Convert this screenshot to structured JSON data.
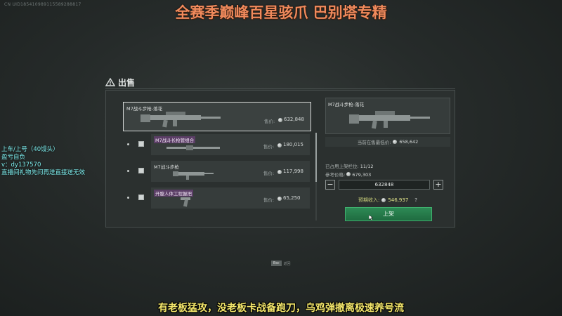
{
  "overlay": {
    "uid": "CN UID185410989115589288817",
    "title": "全赛季巅峰百星骇爪 巴别塔专精",
    "side_lines": [
      "上车/上号（40馒头）",
      "盈亏自负",
      "v：dy137570",
      "直播间礼物先问再送直接送无效"
    ],
    "caption": "有老板猛攻，没老板卡战备跑刀，乌鸡弹撤离极速养号流"
  },
  "header": {
    "title": "出售",
    "icon": "warning-triangle-icon"
  },
  "list": {
    "price_label": "售价:",
    "items": [
      {
        "name": "M7战斗步枪-落花",
        "price": "632,848",
        "selected": true,
        "tagged": false
      },
      {
        "name": "M7战斗长枪管组合",
        "price": "180,015",
        "selected": false,
        "tagged": true
      },
      {
        "name": "M7战斗步枪",
        "price": "117,998",
        "selected": false,
        "tagged": false
      },
      {
        "name": "开膛人体工程握把",
        "price": "65,250",
        "selected": false,
        "tagged": true
      }
    ]
  },
  "detail": {
    "name": "M7战斗步枪-落花",
    "lowest_label": "当前在售最低价:",
    "lowest_value": "658,642",
    "slots_label": "已占用上架栏位:",
    "slots_value": "11/12",
    "ref_label": "参考价格:",
    "ref_value": "679,303",
    "minus": "−",
    "plus": "+",
    "quantity": "632848",
    "income_label": "预期收入:",
    "income_value": "546,937",
    "help": "?",
    "shelf_button": "上架"
  },
  "hint": {
    "key": "Esc",
    "label": "返回"
  }
}
